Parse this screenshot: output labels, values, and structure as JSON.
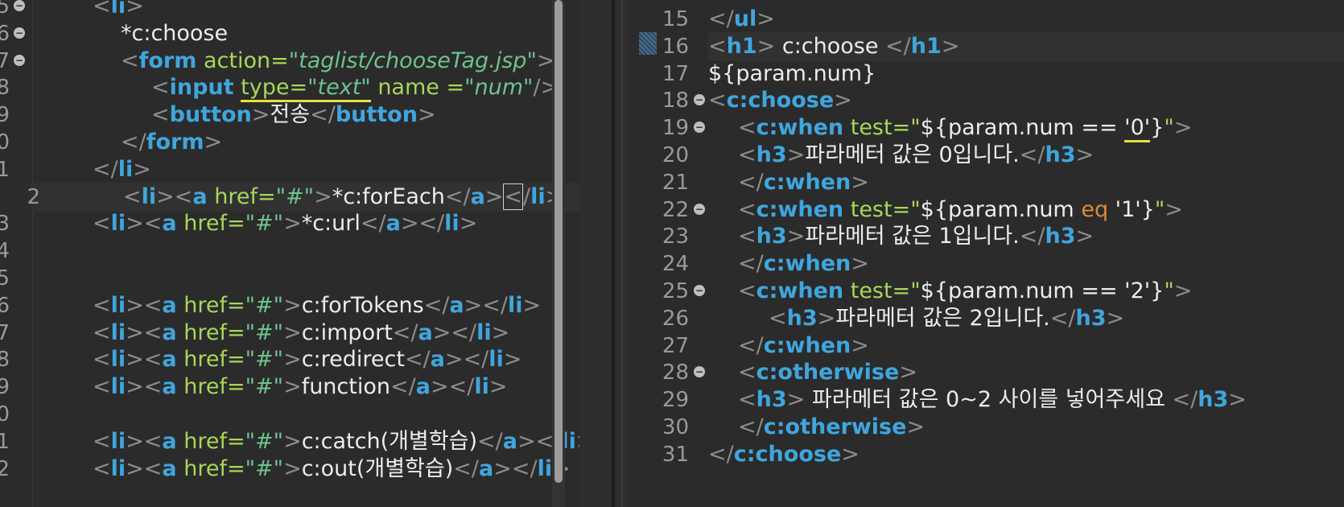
{
  "left_editor": {
    "lines": [
      {
        "num": "5",
        "fold": true
      },
      {
        "num": "6",
        "fold": true
      },
      {
        "num": "7",
        "fold": true
      },
      {
        "num": "8"
      },
      {
        "num": "9"
      },
      {
        "num": "0"
      },
      {
        "num": "1"
      },
      {
        "num": "2"
      },
      {
        "num": "3"
      },
      {
        "num": "4"
      },
      {
        "num": "5"
      },
      {
        "num": "6"
      },
      {
        "num": "7"
      },
      {
        "num": "8"
      },
      {
        "num": "9"
      },
      {
        "num": "0"
      },
      {
        "num": "1"
      },
      {
        "num": "2"
      }
    ],
    "text": {
      "li": "li",
      "a": "a",
      "form": "form",
      "input": "input",
      "button": "button",
      "href_attr": "href",
      "action_attr": "action",
      "type_attr": "type",
      "name_attr": "name",
      "hash": "\"#\"",
      "action_val": "\"taglist/chooseTag.jsp\"",
      "type_val": "\"text\"",
      "name_val": "\"num\"",
      "c_choose": "*c:choose",
      "send": "전송",
      "c_foreach": "*c:forEach",
      "c_url": "*c:url",
      "c_fortokens": "c:forTokens",
      "c_import": "c:import",
      "c_redirect": "c:redirect",
      "function": "function",
      "c_catch": "c:catch(개별학습)",
      "c_out": "c:out(개별학습)"
    }
  },
  "right_editor": {
    "lines": [
      {
        "num": "15"
      },
      {
        "num": "16"
      },
      {
        "num": "17"
      },
      {
        "num": "18",
        "fold": true
      },
      {
        "num": "19",
        "fold": true
      },
      {
        "num": "20"
      },
      {
        "num": "21"
      },
      {
        "num": "22",
        "fold": true
      },
      {
        "num": "23"
      },
      {
        "num": "24"
      },
      {
        "num": "25",
        "fold": true
      },
      {
        "num": "26"
      },
      {
        "num": "27"
      },
      {
        "num": "28",
        "fold": true
      },
      {
        "num": "29"
      },
      {
        "num": "30"
      },
      {
        "num": "31"
      }
    ],
    "text": {
      "ul": "ul",
      "h1": "h1",
      "h3": "h3",
      "c_choose_tag": "c:choose",
      "c_when": "c:when",
      "c_otherwise": "c:otherwise",
      "test_attr": "test",
      "h1_content": " c:choose ",
      "param_num": "${param.num}",
      "expr_prefix": "${param.num == ",
      "expr_eq_prefix": "${param.num ",
      "eq_kw": "eq",
      "val0": "'0'",
      "val1": " '1'}",
      "val2": "'2'}",
      "msg0": "파라메터 값은 0입니다.",
      "msg1": "파라메터 값은 1입니다.",
      "msg2": "파라메터 값은 2입니다.",
      "msg_other": " 파라메터 값은 0~2 사이를 넣어주세요 "
    }
  }
}
